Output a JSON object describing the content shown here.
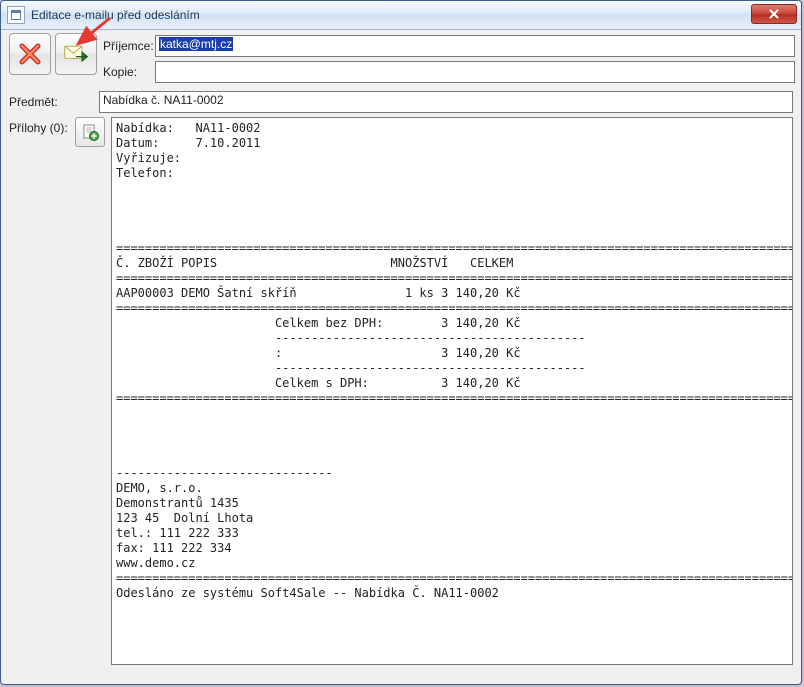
{
  "window": {
    "title": "Editace e-mailu před odesláním"
  },
  "labels": {
    "recipient": "Příjemce:",
    "cc": "Kopie:",
    "subject": "Předmět:",
    "attachments": "Přílohy (0):"
  },
  "fields": {
    "recipient": "katka@mtj.cz",
    "cc": "",
    "subject": "Nabídka č. NA11-0002"
  },
  "body": {
    "offer_label": "Nabídka:",
    "offer_value": "NA11-0002",
    "date_label": "Datum:",
    "date_value": "7.10.2011",
    "handler_label": "Vyřizuje:",
    "phone_label": "Telefon:",
    "col_code": "Č. ZBOŽÍ",
    "col_desc": "POPIS",
    "col_qty": "MNOŽSTVÍ",
    "col_total": "CELKEM",
    "item_code": "AAP00003",
    "item_desc": "DEMO Šatní skříň",
    "item_qty": "1 ks",
    "item_total": "3 140,20 Kč",
    "sum_novat_label": "Celkem bez DPH:",
    "sum_novat_value": "3 140,20 Kč",
    "sum_mid_label": ":",
    "sum_mid_value": "3 140,20 Kč",
    "sum_vat_label": "Celkem s DPH:",
    "sum_vat_value": "3 140,20 Kč",
    "company": "DEMO, s.r.o.",
    "street": "Demonstrantů 1435",
    "city": "123 45  Dolní Lhota",
    "tel": "tel.: 111 222 333",
    "fax": "fax: 111 222 334",
    "web": "www.demo.cz",
    "footer": "Odesláno ze systému Soft4Sale -- Nabídka Č. NA11-0002"
  },
  "sep": {
    "eq_long": "===============================================================================================================",
    "dash_mid": "-------------------------------------------",
    "dash_short": "------------------------------"
  }
}
